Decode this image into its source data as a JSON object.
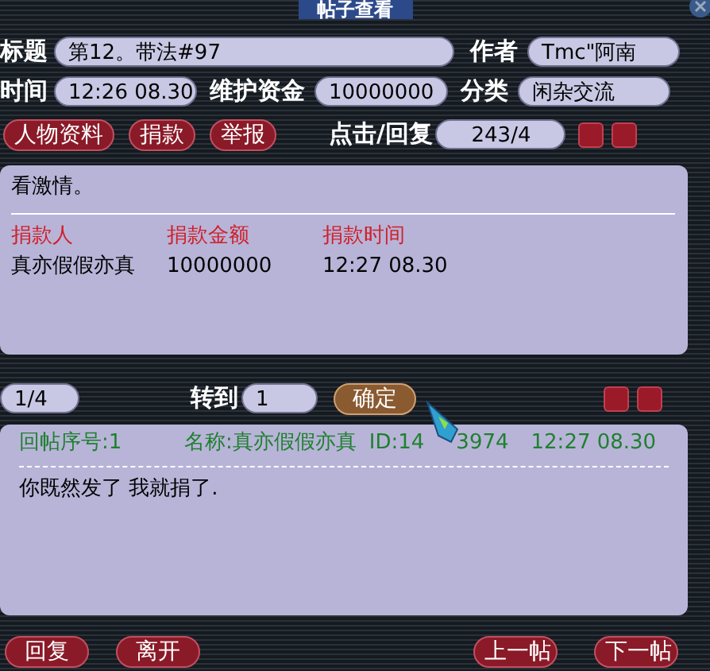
{
  "window": {
    "title": "帖子查看"
  },
  "fields": [
    {
      "label": "标题",
      "value": "第12。带法#97"
    },
    {
      "label": "作者",
      "value": "Tmc\"阿南"
    },
    {
      "label": "时间",
      "value": "12:26 08.30"
    },
    {
      "label": "维护资金",
      "value": "10000000"
    },
    {
      "label": "分类",
      "value": "闲杂交流"
    }
  ],
  "actions": [
    "人物资料",
    "捐款",
    "举报"
  ],
  "hits": {
    "label": "点击/回复",
    "value": "243/4"
  },
  "post": {
    "text": "看激情。",
    "columns": [
      "捐款人",
      "捐款金额",
      "捐款时间"
    ],
    "rows": [
      [
        "真亦假假亦真",
        "10000000",
        "12:27 08.30"
      ]
    ]
  },
  "pager": {
    "page": "1/4",
    "goto_label": "转到",
    "goto_value": "1",
    "confirm": "确定"
  },
  "reply": {
    "number": "回帖序号:1",
    "name": "名称:真亦假假亦真",
    "id_start": "ID:14",
    "id_end": "3974",
    "time": "12:27 08.30",
    "text": "你既然发了 我就捐了."
  },
  "bottom_left": [
    "回复",
    "离开"
  ],
  "bottom_right": [
    "上一帖",
    "下一帖"
  ]
}
